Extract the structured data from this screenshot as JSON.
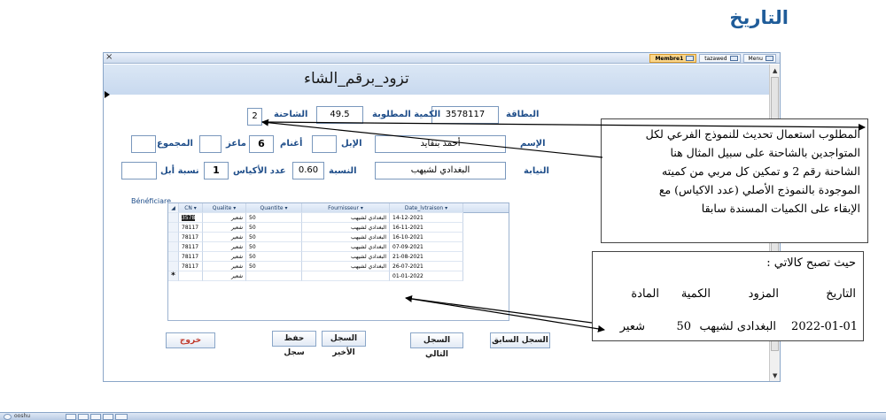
{
  "page_heading": "التاريخ",
  "window": {
    "close_glyph": "×",
    "tabs": [
      {
        "label": "Membre1",
        "active": true
      },
      {
        "label": "tazawed",
        "active": false
      },
      {
        "label": "Menu",
        "active": false
      }
    ]
  },
  "form": {
    "title": "تزود_برقم_الشاء",
    "fields": {
      "card": {
        "label": "البطاقة",
        "value": "3578117"
      },
      "requested_qty": {
        "label": "الكمية المطلوبة",
        "value": "49.5"
      },
      "truck": {
        "label": "الشاحنة",
        "value": "2"
      },
      "name": {
        "label": "الإسم",
        "value": "أحمد بنقايد"
      },
      "camels": {
        "label": "الإبل",
        "value": ""
      },
      "sheep": {
        "label": "أغنام",
        "value": "6"
      },
      "goats": {
        "label": "ماعز",
        "value": ""
      },
      "total": {
        "label": "المجموع",
        "value": ""
      },
      "office": {
        "label": "النيابة",
        "value": "البغدادي لشيهب"
      },
      "ratio": {
        "label": "النسبة",
        "value": "0.60"
      },
      "bag_count": {
        "label": "عدد الأكياس",
        "value": "1"
      },
      "camel_ratio": {
        "label": "نسبة أبل",
        "value": ""
      }
    },
    "subform_label": "Bénéficiare",
    "datasheet": {
      "columns": [
        "CN",
        "Qualite",
        "Quantite",
        "Fournisseur",
        "Date_lvtraison"
      ],
      "rows": [
        {
          "cn": "3578",
          "qualite": "شعير",
          "quantite": "50",
          "fournisseur": "البغدادي لشيهب",
          "date": "14-12-2021"
        },
        {
          "cn": "78117",
          "qualite": "شعير",
          "quantite": "50",
          "fournisseur": "البغدادي لشيهب",
          "date": "16-11-2021"
        },
        {
          "cn": "78117",
          "qualite": "شعير",
          "quantite": "50",
          "fournisseur": "البغدادي لشيهب",
          "date": "16-10-2021"
        },
        {
          "cn": "78117",
          "qualite": "شعير",
          "quantite": "50",
          "fournisseur": "البغدادي لشيهب",
          "date": "07-09-2021"
        },
        {
          "cn": "78117",
          "qualite": "شعير",
          "quantite": "50",
          "fournisseur": "البغدادي لشيهب",
          "date": "21-08-2021"
        },
        {
          "cn": "78117",
          "qualite": "شعير",
          "quantite": "50",
          "fournisseur": "البغدادي لشيهب",
          "date": "26-07-2021"
        }
      ],
      "new_row": {
        "marker": "*",
        "qualite": "شعير",
        "date": "01-01-2022"
      }
    },
    "buttons": {
      "exit": "خروج",
      "save": "حفظ سجل",
      "last": "السجل الأخير",
      "next": "السجل التالي",
      "previous": "السجل السابق"
    }
  },
  "note": {
    "lines": [
      "المطلوب استعمال تحديث  للنموذج الفرعي لكل",
      "المتواجدين بالشاحنة على سبيل المثال هنا",
      "الشاحنة رقم 2 و تمكين كل مربي من كميته",
      "الموجودة بالنموذج الأصلي (عدد الاكياس) مع",
      "الإبقاء على الكميات المسندة سابقا"
    ]
  },
  "result": {
    "title": "حيث تصبح كالاتي :",
    "headers": {
      "material": "المادة",
      "quantity": "الكمية",
      "supplier": "المزود",
      "date": "التاريخ"
    },
    "values": {
      "material": "شعير",
      "quantity": "50",
      "supplier": "البغدادى لشيهب",
      "date": "2022-01-01"
    }
  },
  "taskbar": {
    "text": "ooshu"
  }
}
